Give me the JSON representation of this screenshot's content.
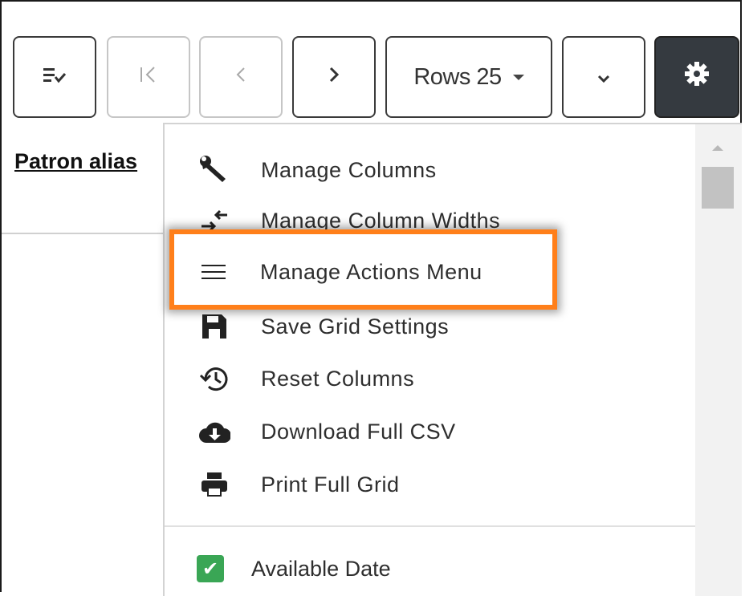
{
  "toolbar": {
    "rows_label": "Rows 25",
    "buttons": {
      "filter": "filter-checklist-icon",
      "first": "first-page-icon",
      "prev": "previous-page-icon",
      "next": "next-page-icon",
      "expand": "chevron-down-icon",
      "settings": "gear-icon"
    }
  },
  "grid": {
    "column_header": "Patron alias"
  },
  "settings_menu": {
    "items": [
      {
        "label": "Manage Columns",
        "icon": "wrench-icon"
      },
      {
        "label": "Manage Column Widths",
        "icon": "resize-columns-icon"
      },
      {
        "label": "Manage Actions Menu",
        "icon": "hamburger-menu-icon"
      },
      {
        "label": "Save Grid Settings",
        "icon": "save-icon"
      },
      {
        "label": "Reset Columns",
        "icon": "history-reset-icon"
      },
      {
        "label": "Download Full CSV",
        "icon": "cloud-download-icon"
      },
      {
        "label": "Print Full Grid",
        "icon": "printer-icon"
      }
    ],
    "checkbox_items": [
      {
        "label": "Available Date",
        "checked": true,
        "check_color": "#3aa655"
      }
    ],
    "highlighted_item": "Manage Actions Menu"
  },
  "colors": {
    "highlight_border": "#ff7f1a",
    "settings_button_bg": "#353a40",
    "text": "#2e2e2e"
  }
}
